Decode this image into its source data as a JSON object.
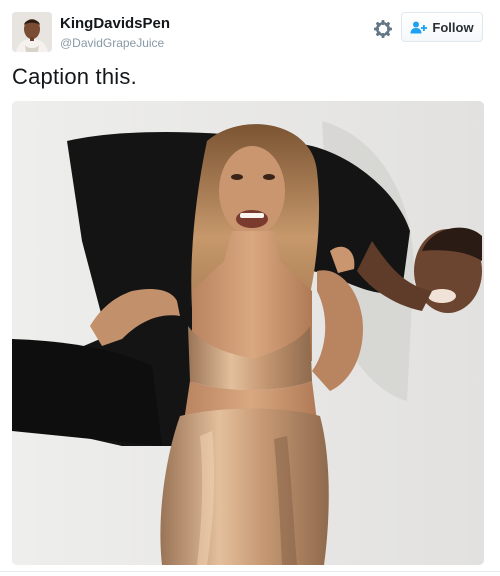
{
  "author": {
    "display_name": "KingDavidsPen",
    "handle": "@DavidGrapeJuice"
  },
  "header": {
    "follow_label": "Follow",
    "settings_icon": "gear-icon",
    "follow_icon": "add-person-icon"
  },
  "tweet": {
    "text": "Caption this."
  },
  "colors": {
    "follow_accent": "#1da1f2",
    "name_text": "#14171a",
    "handle_text": "#8899a6"
  }
}
